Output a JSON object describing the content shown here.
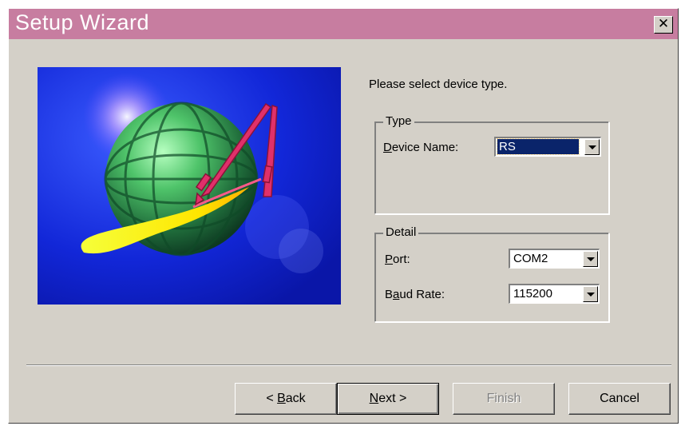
{
  "window": {
    "title": "Setup Wizard",
    "close_symbol": "✕",
    "title_color": "#c77da0"
  },
  "image": {
    "icon": "globe-with-probes-illustration"
  },
  "prompt": "Please select device type.",
  "type_group": {
    "legend": "Type",
    "device_name_label_prefix": "",
    "device_name_label_key": "D",
    "device_name_label_rest": "evice Name:",
    "device_name_value": "RS"
  },
  "detail_group": {
    "legend": "Detail",
    "port_label_key": "P",
    "port_label_rest": "ort:",
    "port_value": "COM2",
    "baud_label_prefix": "B",
    "baud_label_key": "a",
    "baud_label_rest": "ud Rate:",
    "baud_value": "115200"
  },
  "buttons": {
    "back_prefix": "< ",
    "back_key": "B",
    "back_rest": "ack",
    "next_key": "N",
    "next_rest": "ext >",
    "finish": "Finish",
    "cancel": "Cancel"
  }
}
